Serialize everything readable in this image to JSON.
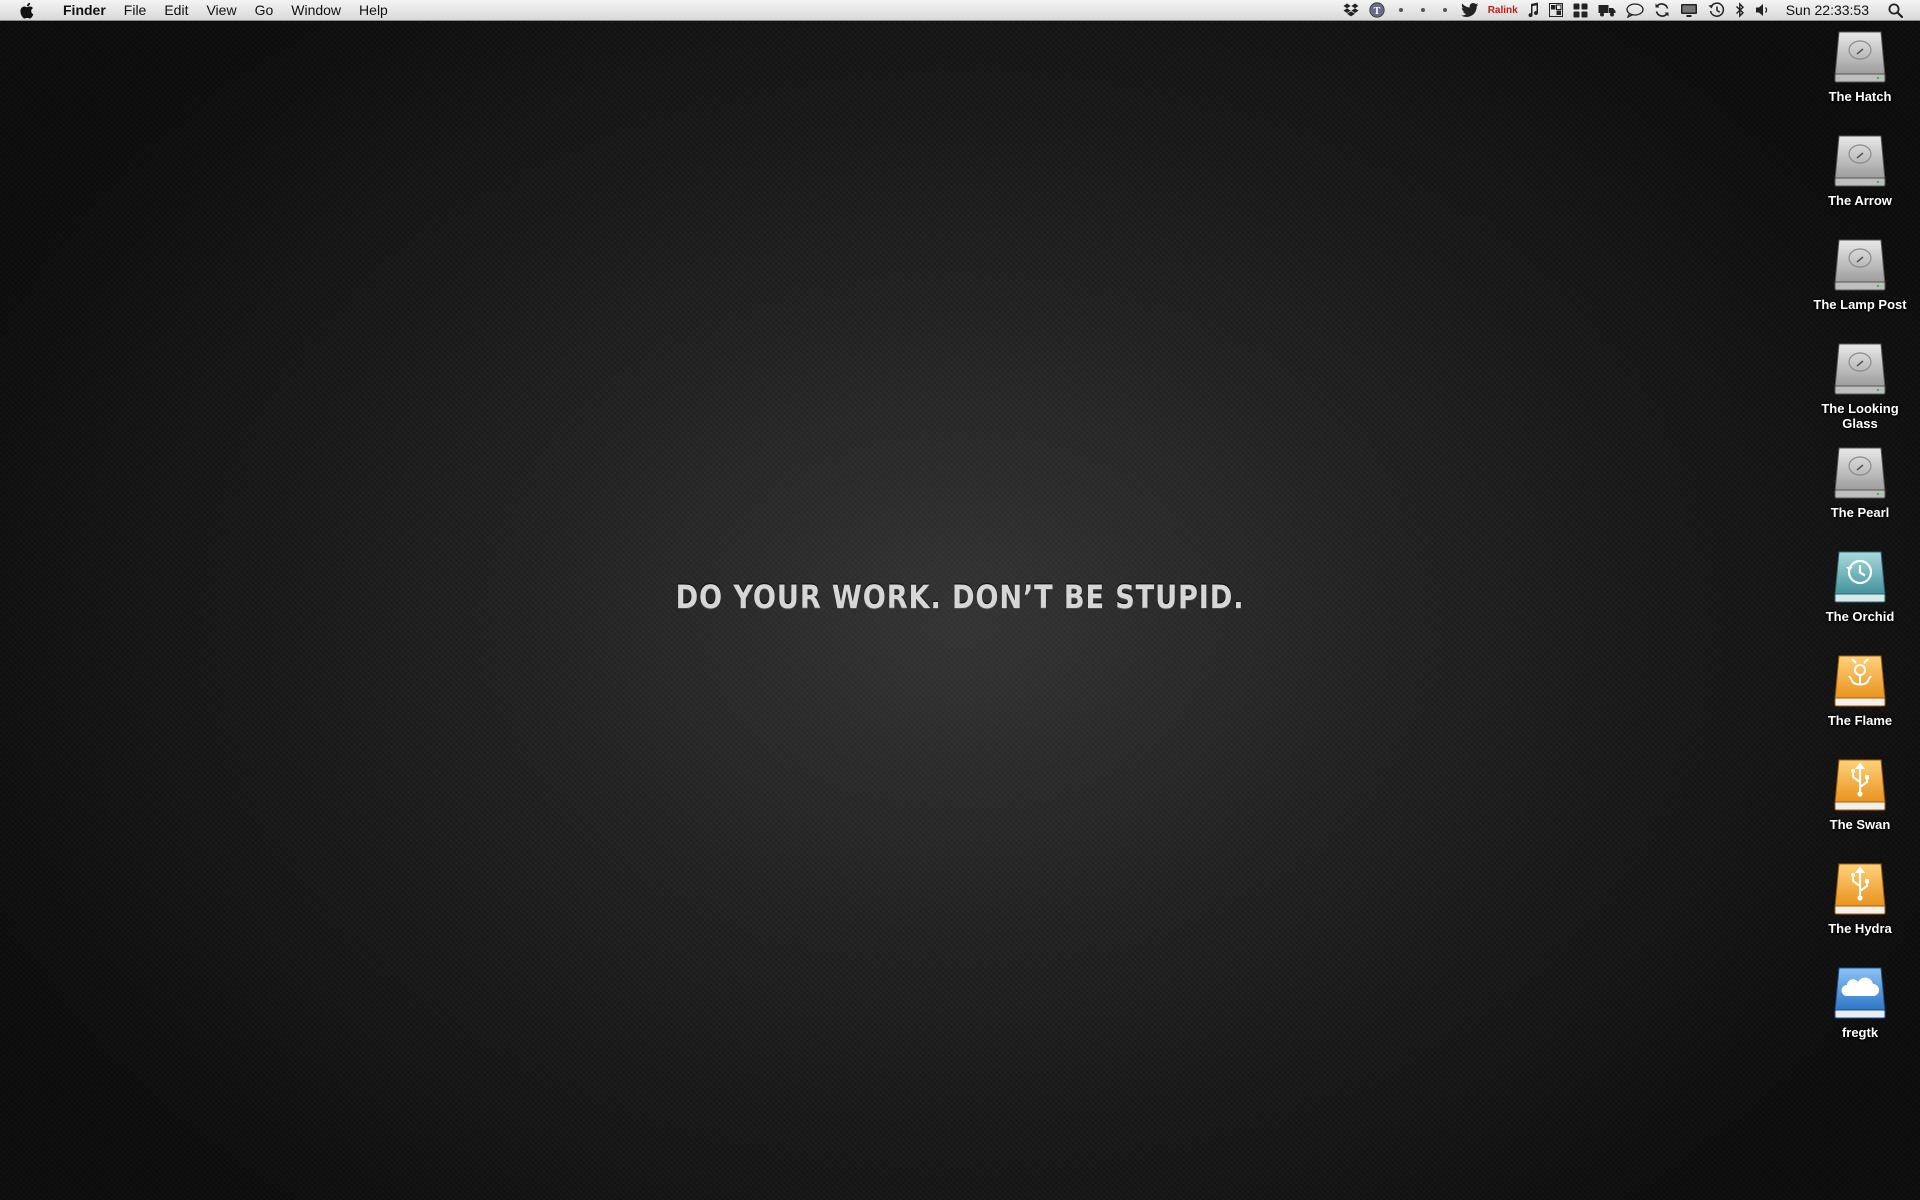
{
  "menubar": {
    "app_name": "Finder",
    "menus": [
      "File",
      "Edit",
      "View",
      "Go",
      "Window",
      "Help"
    ],
    "tray_icons": [
      "dropbox-icon",
      "textexpander-icon",
      "dot-icon",
      "dot-icon",
      "dot-icon",
      "twitter-icon",
      "ralink-wireless",
      "music-note-icon",
      "grid-icon",
      "apps-grid-icon",
      "truck-icon",
      "speech-bubble-icon",
      "sync-icon",
      "display-icon",
      "time-machine-icon",
      "bluetooth-icon",
      "volume-icon",
      "spotlight-icon"
    ],
    "ralink_label": "Ralink",
    "clock": "Sun 22:33:53"
  },
  "wallpaper": {
    "motto": "DO YOUR WORK. DON’T BE STUPID."
  },
  "desktop": {
    "icons": [
      {
        "label": "The Hatch",
        "type": "internal-drive"
      },
      {
        "label": "The Arrow",
        "type": "internal-drive"
      },
      {
        "label": "The Lamp Post",
        "type": "internal-drive"
      },
      {
        "label": "The Looking Glass",
        "type": "internal-drive"
      },
      {
        "label": "The Pearl",
        "type": "internal-drive"
      },
      {
        "label": "The Orchid",
        "type": "time-machine-drive"
      },
      {
        "label": "The Flame",
        "type": "firewire-drive"
      },
      {
        "label": "The Swan",
        "type": "usb-drive"
      },
      {
        "label": "The Hydra",
        "type": "usb-drive"
      },
      {
        "label": "fregtk",
        "type": "icloud-drive"
      }
    ]
  },
  "colors": {
    "menubar_top": "#f4f4f4",
    "menubar_bottom": "#d9d9d9",
    "wallpaper": "#1b1b1b",
    "external_drive": "#f3a52c",
    "timemachine_drive": "#5fb0b8",
    "cloud_drive": "#3f8fd8"
  }
}
